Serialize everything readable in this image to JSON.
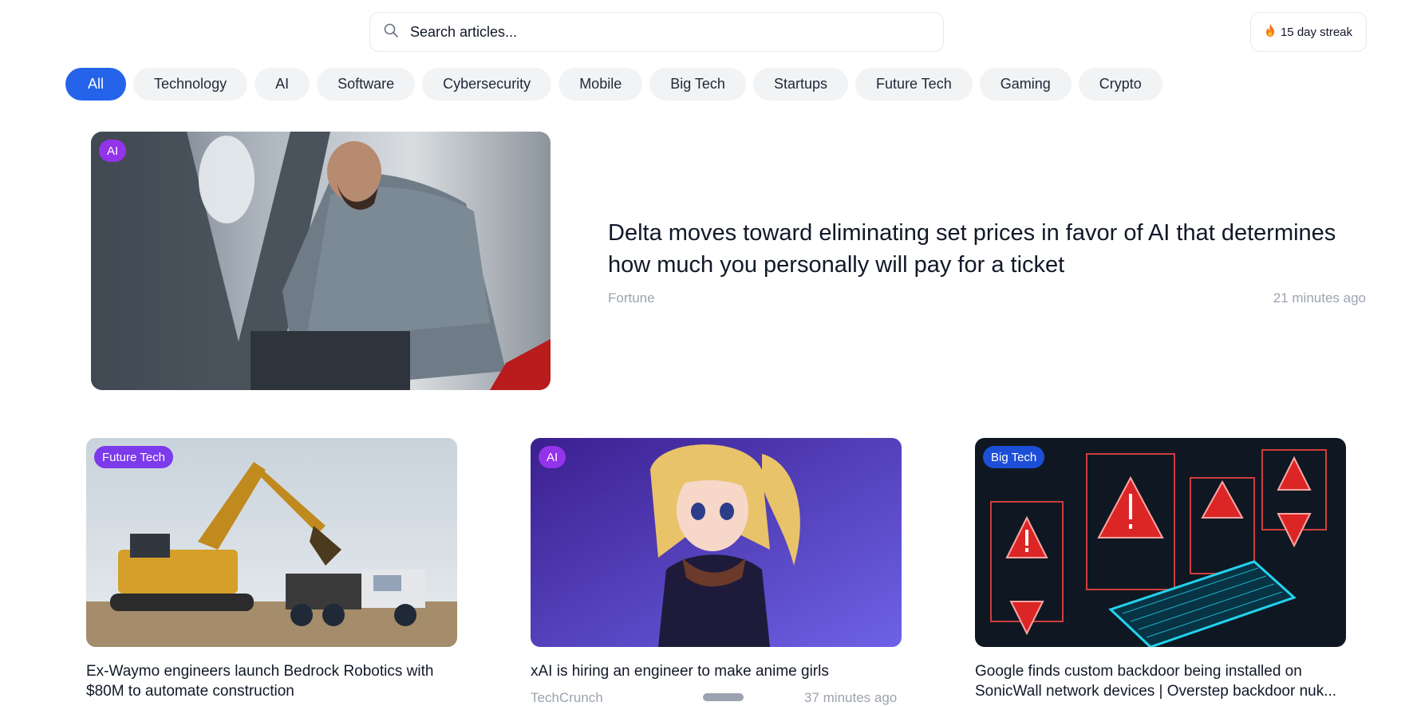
{
  "search": {
    "placeholder": "Search articles..."
  },
  "streak": {
    "label": "15 day streak"
  },
  "categories": [
    {
      "label": "All",
      "active": true
    },
    {
      "label": "Technology"
    },
    {
      "label": "AI"
    },
    {
      "label": "Software"
    },
    {
      "label": "Cybersecurity"
    },
    {
      "label": "Mobile"
    },
    {
      "label": "Big Tech"
    },
    {
      "label": "Startups"
    },
    {
      "label": "Future Tech"
    },
    {
      "label": "Gaming"
    },
    {
      "label": "Crypto"
    }
  ],
  "featured": {
    "badge": "AI",
    "title": "Delta moves toward eliminating set prices in favor of AI that determines how much you personally will pay for a ticket",
    "source": "Fortune",
    "time": "21 minutes ago"
  },
  "cards": [
    {
      "badge": "Future Tech",
      "title": "Ex-Waymo engineers launch Bedrock Robotics with $80M to automate construction",
      "source": "",
      "time": ""
    },
    {
      "badge": "AI",
      "title": "xAI is hiring an engineer to make anime girls",
      "source": "TechCrunch",
      "time": "37 minutes ago"
    },
    {
      "badge": "Big Tech",
      "title": "Google finds custom backdoor being installed on SonicWall network devices | Overstep backdoor nuk...",
      "source": "",
      "time": ""
    }
  ],
  "icons": {
    "search": "search-icon",
    "streak": "flame-icon"
  },
  "colors": {
    "accent": "#2563eb",
    "badge_ai": "#9333ea",
    "badge_future_tech": "#7c3aed",
    "badge_big_tech": "#1d4ed8",
    "muted_text": "#9ca3af",
    "pill_bg": "#f1f3f5"
  }
}
